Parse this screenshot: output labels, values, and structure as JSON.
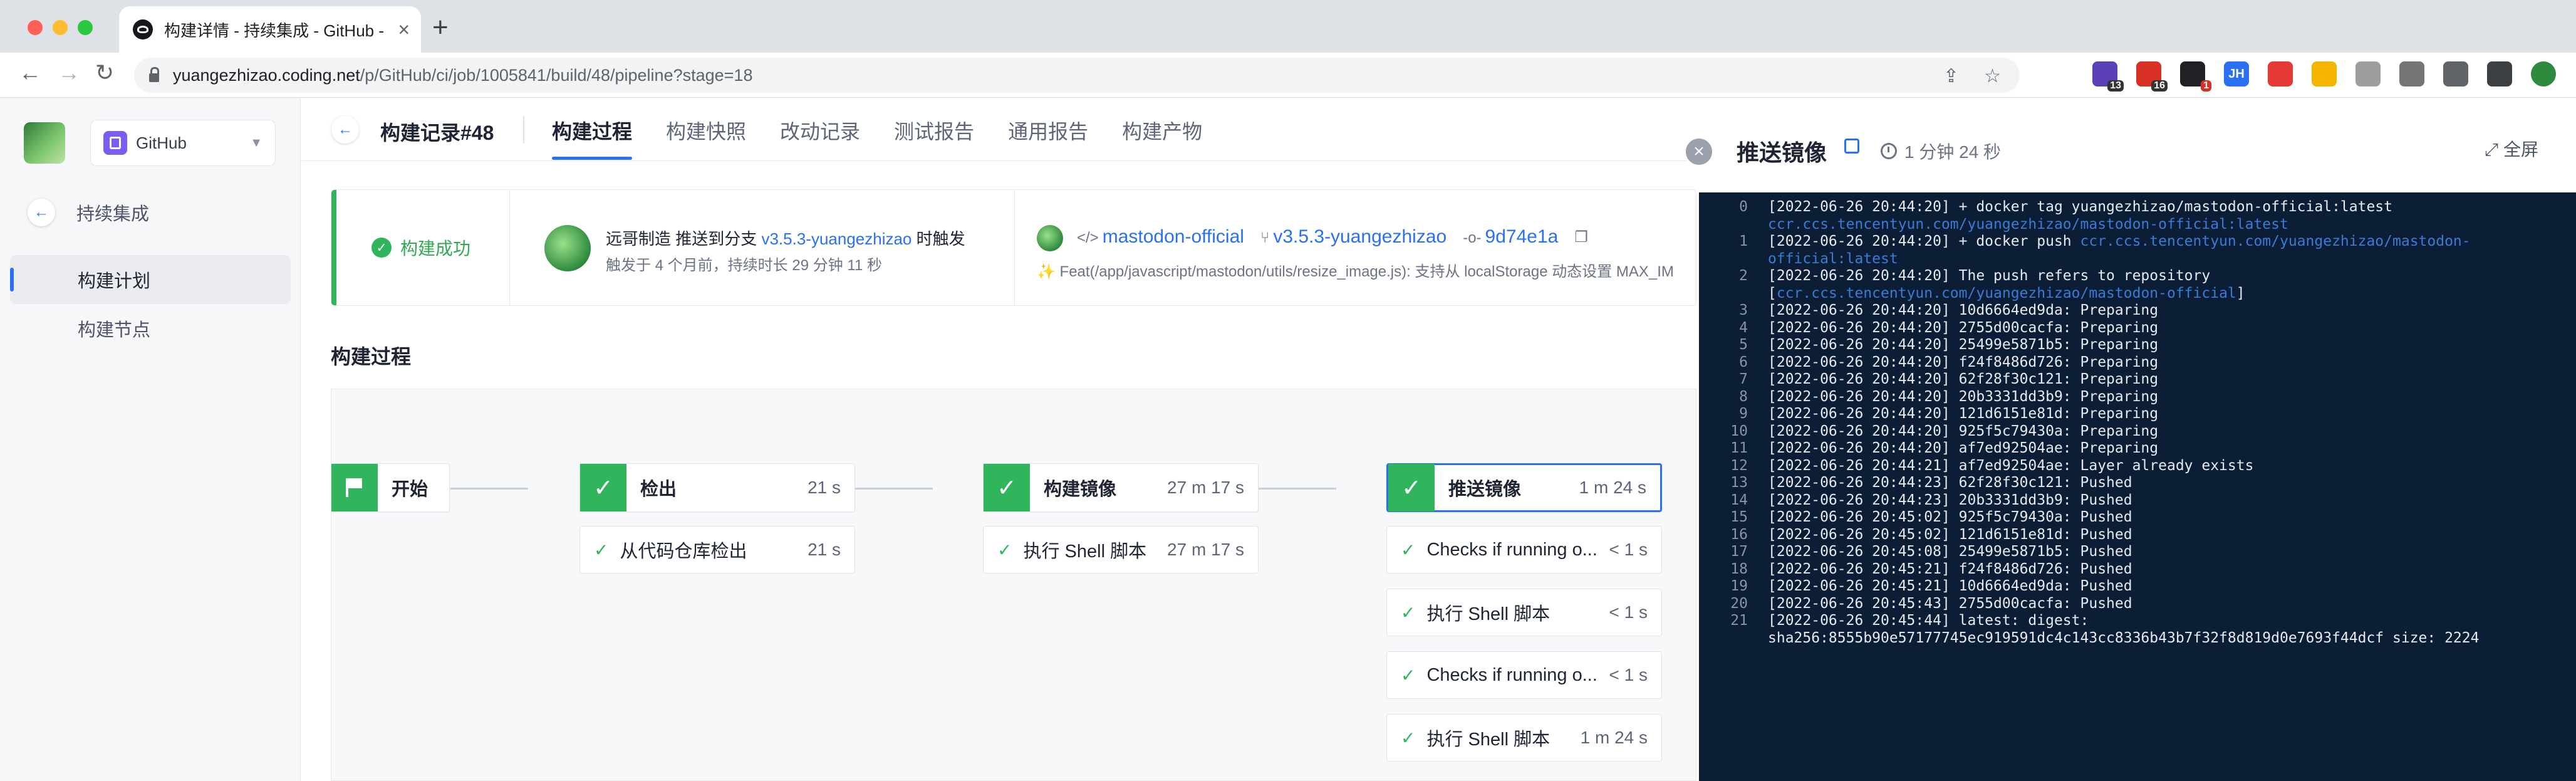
{
  "browser": {
    "tab_title": "构建详情 - 持续集成 - GitHub -",
    "url_prefix": "yuangezhizao.coding.net",
    "url_rest": "/p/GitHub/ci/job/1005841/build/48/pipeline?stage=18",
    "extensions": [
      {
        "name": "ext-graduation-icon",
        "color": "#5b3fb5",
        "badge": "13",
        "badge_style": "dark",
        "label": ""
      },
      {
        "name": "ext-red-icon",
        "color": "#d93025",
        "badge": "16",
        "badge_style": "dark",
        "label": ""
      },
      {
        "name": "ext-black-icon",
        "color": "#202124",
        "badge": "1",
        "badge_style": "red",
        "label": ""
      },
      {
        "name": "ext-jh-icon",
        "color": "#2a70f5",
        "badge": "",
        "badge_style": "",
        "label": "JH"
      },
      {
        "name": "ext-balloon-icon",
        "color": "#e53935",
        "badge": "",
        "badge_style": "",
        "label": ""
      },
      {
        "name": "ext-face-icon",
        "color": "#f4b400",
        "badge": "",
        "badge_style": "",
        "label": ""
      },
      {
        "name": "ext-cow-icon",
        "color": "#9e9e9e",
        "badge": "",
        "badge_style": "",
        "label": ""
      },
      {
        "name": "ext-grey-icon",
        "color": "#757575",
        "badge": "",
        "badge_style": "",
        "label": ""
      },
      {
        "name": "puzzle-icon",
        "color": "#5f6368",
        "badge": "",
        "badge_style": "",
        "label": ""
      },
      {
        "name": "sidepanel-icon",
        "color": "#3c4043",
        "badge": "",
        "badge_style": "",
        "label": ""
      },
      {
        "name": "profile-avatar",
        "color": "#2e8b3e",
        "badge": "",
        "badge_style": "",
        "label": ""
      }
    ]
  },
  "sidebar": {
    "project_name": "GitHub",
    "back_label": "持续集成",
    "items": [
      {
        "label": "构建计划",
        "active": true
      },
      {
        "label": "构建节点",
        "active": false
      }
    ]
  },
  "header": {
    "build_title": "构建记录#48",
    "tabs": [
      {
        "label": "构建过程",
        "active": true
      },
      {
        "label": "构建快照",
        "active": false
      },
      {
        "label": "改动记录",
        "active": false
      },
      {
        "label": "测试报告",
        "active": false
      },
      {
        "label": "通用报告",
        "active": false
      },
      {
        "label": "构建产物",
        "active": false
      }
    ]
  },
  "summary": {
    "status": "构建成功",
    "trigger_prefix": "远哥制造 推送到分支 ",
    "trigger_branch": "v3.5.3-yuangezhizao",
    "trigger_suffix": " 时触发",
    "trigger_time": "触发于 4 个月前，持续时长 29 分钟 11 秒",
    "repo": "mastodon-official",
    "branch": "v3.5.3-yuangezhizao",
    "commit": "9d74e1a",
    "commit_message": "✨ Feat(/app/javascript/mastodon/utils/resize_image.js): 支持从 localStorage 动态设置 MAX_IM"
  },
  "pipeline": {
    "title": "构建过程",
    "stages": [
      {
        "name": "开始",
        "time": "",
        "icon": "flag-icon",
        "steps": []
      },
      {
        "name": "检出",
        "time": "21 s",
        "icon": "check-icon",
        "steps": [
          {
            "name": "从代码仓库检出",
            "time": "21 s"
          }
        ]
      },
      {
        "name": "构建镜像",
        "time": "27 m 17 s",
        "icon": "check-icon",
        "steps": [
          {
            "name": "执行 Shell 脚本",
            "time": "27 m 17 s"
          }
        ]
      },
      {
        "name": "推送镜像",
        "time": "1 m 24 s",
        "icon": "check-icon",
        "selected": true,
        "steps": [
          {
            "name": "Checks if running o...",
            "time": "< 1 s"
          },
          {
            "name": "执行 Shell 脚本",
            "time": "< 1 s"
          },
          {
            "name": "Checks if running o...",
            "time": "< 1 s"
          },
          {
            "name": "执行 Shell 脚本",
            "time": "1 m 24 s"
          }
        ]
      }
    ]
  },
  "log_panel": {
    "title": "推送镜像",
    "duration": "1 分钟 24 秒",
    "fullscreen_label": "全屏",
    "lines": [
      {
        "n": "0",
        "rows": [
          [
            {
              "t": "[2022-06-26 20:44:20] + docker tag yuangezhizao/mastodon-official:latest "
            }
          ],
          [
            {
              "t": "ccr.ccs.tencentyun.com/yuangezhizao/mastodon-official:latest",
              "link": true
            }
          ]
        ]
      },
      {
        "n": "1",
        "rows": [
          [
            {
              "t": "[2022-06-26 20:44:20] + docker push "
            },
            {
              "t": "ccr.ccs.tencentyun.com/yuangezhizao/mastodon-",
              "link": true
            }
          ],
          [
            {
              "t": "official:latest",
              "link": true
            }
          ]
        ]
      },
      {
        "n": "2",
        "rows": [
          [
            {
              "t": "[2022-06-26 20:44:20] The push refers to repository "
            }
          ],
          [
            {
              "t": "["
            },
            {
              "t": "ccr.ccs.tencentyun.com/yuangezhizao/mastodon-official",
              "link": true
            },
            {
              "t": "]"
            }
          ]
        ]
      },
      {
        "n": "3",
        "rows": [
          [
            {
              "t": "[2022-06-26 20:44:20] 10d6664ed9da: Preparing"
            }
          ]
        ]
      },
      {
        "n": "4",
        "rows": [
          [
            {
              "t": "[2022-06-26 20:44:20] 2755d00cacfa: Preparing"
            }
          ]
        ]
      },
      {
        "n": "5",
        "rows": [
          [
            {
              "t": "[2022-06-26 20:44:20] 25499e5871b5: Preparing"
            }
          ]
        ]
      },
      {
        "n": "6",
        "rows": [
          [
            {
              "t": "[2022-06-26 20:44:20] f24f8486d726: Preparing"
            }
          ]
        ]
      },
      {
        "n": "7",
        "rows": [
          [
            {
              "t": "[2022-06-26 20:44:20] 62f28f30c121: Preparing"
            }
          ]
        ]
      },
      {
        "n": "8",
        "rows": [
          [
            {
              "t": "[2022-06-26 20:44:20] 20b3331dd3b9: Preparing"
            }
          ]
        ]
      },
      {
        "n": "9",
        "rows": [
          [
            {
              "t": "[2022-06-26 20:44:20] 121d6151e81d: Preparing"
            }
          ]
        ]
      },
      {
        "n": "10",
        "rows": [
          [
            {
              "t": "[2022-06-26 20:44:20] 925f5c79430a: Preparing"
            }
          ]
        ]
      },
      {
        "n": "11",
        "rows": [
          [
            {
              "t": "[2022-06-26 20:44:20] af7ed92504ae: Preparing"
            }
          ]
        ]
      },
      {
        "n": "12",
        "rows": [
          [
            {
              "t": "[2022-06-26 20:44:21] af7ed92504ae: Layer already exists"
            }
          ]
        ]
      },
      {
        "n": "13",
        "rows": [
          [
            {
              "t": "[2022-06-26 20:44:23] 62f28f30c121: Pushed"
            }
          ]
        ]
      },
      {
        "n": "14",
        "rows": [
          [
            {
              "t": "[2022-06-26 20:44:23] 20b3331dd3b9: Pushed"
            }
          ]
        ]
      },
      {
        "n": "15",
        "rows": [
          [
            {
              "t": "[2022-06-26 20:45:02] 925f5c79430a: Pushed"
            }
          ]
        ]
      },
      {
        "n": "16",
        "rows": [
          [
            {
              "t": "[2022-06-26 20:45:02] 121d6151e81d: Pushed"
            }
          ]
        ]
      },
      {
        "n": "17",
        "rows": [
          [
            {
              "t": "[2022-06-26 20:45:08] 25499e5871b5: Pushed"
            }
          ]
        ]
      },
      {
        "n": "18",
        "rows": [
          [
            {
              "t": "[2022-06-26 20:45:21] f24f8486d726: Pushed"
            }
          ]
        ]
      },
      {
        "n": "19",
        "rows": [
          [
            {
              "t": "[2022-06-26 20:45:21] 10d6664ed9da: Pushed"
            }
          ]
        ]
      },
      {
        "n": "20",
        "rows": [
          [
            {
              "t": "[2022-06-26 20:45:43] 2755d00cacfa: Pushed"
            }
          ]
        ]
      },
      {
        "n": "21",
        "rows": [
          [
            {
              "t": "[2022-06-26 20:45:44] latest: digest: "
            }
          ],
          [
            {
              "t": "sha256:8555b90e57177745ec919591dc4c143cc8336b43b7f32f8d819d0e7693f44dcf size: 2224"
            }
          ]
        ]
      }
    ]
  }
}
